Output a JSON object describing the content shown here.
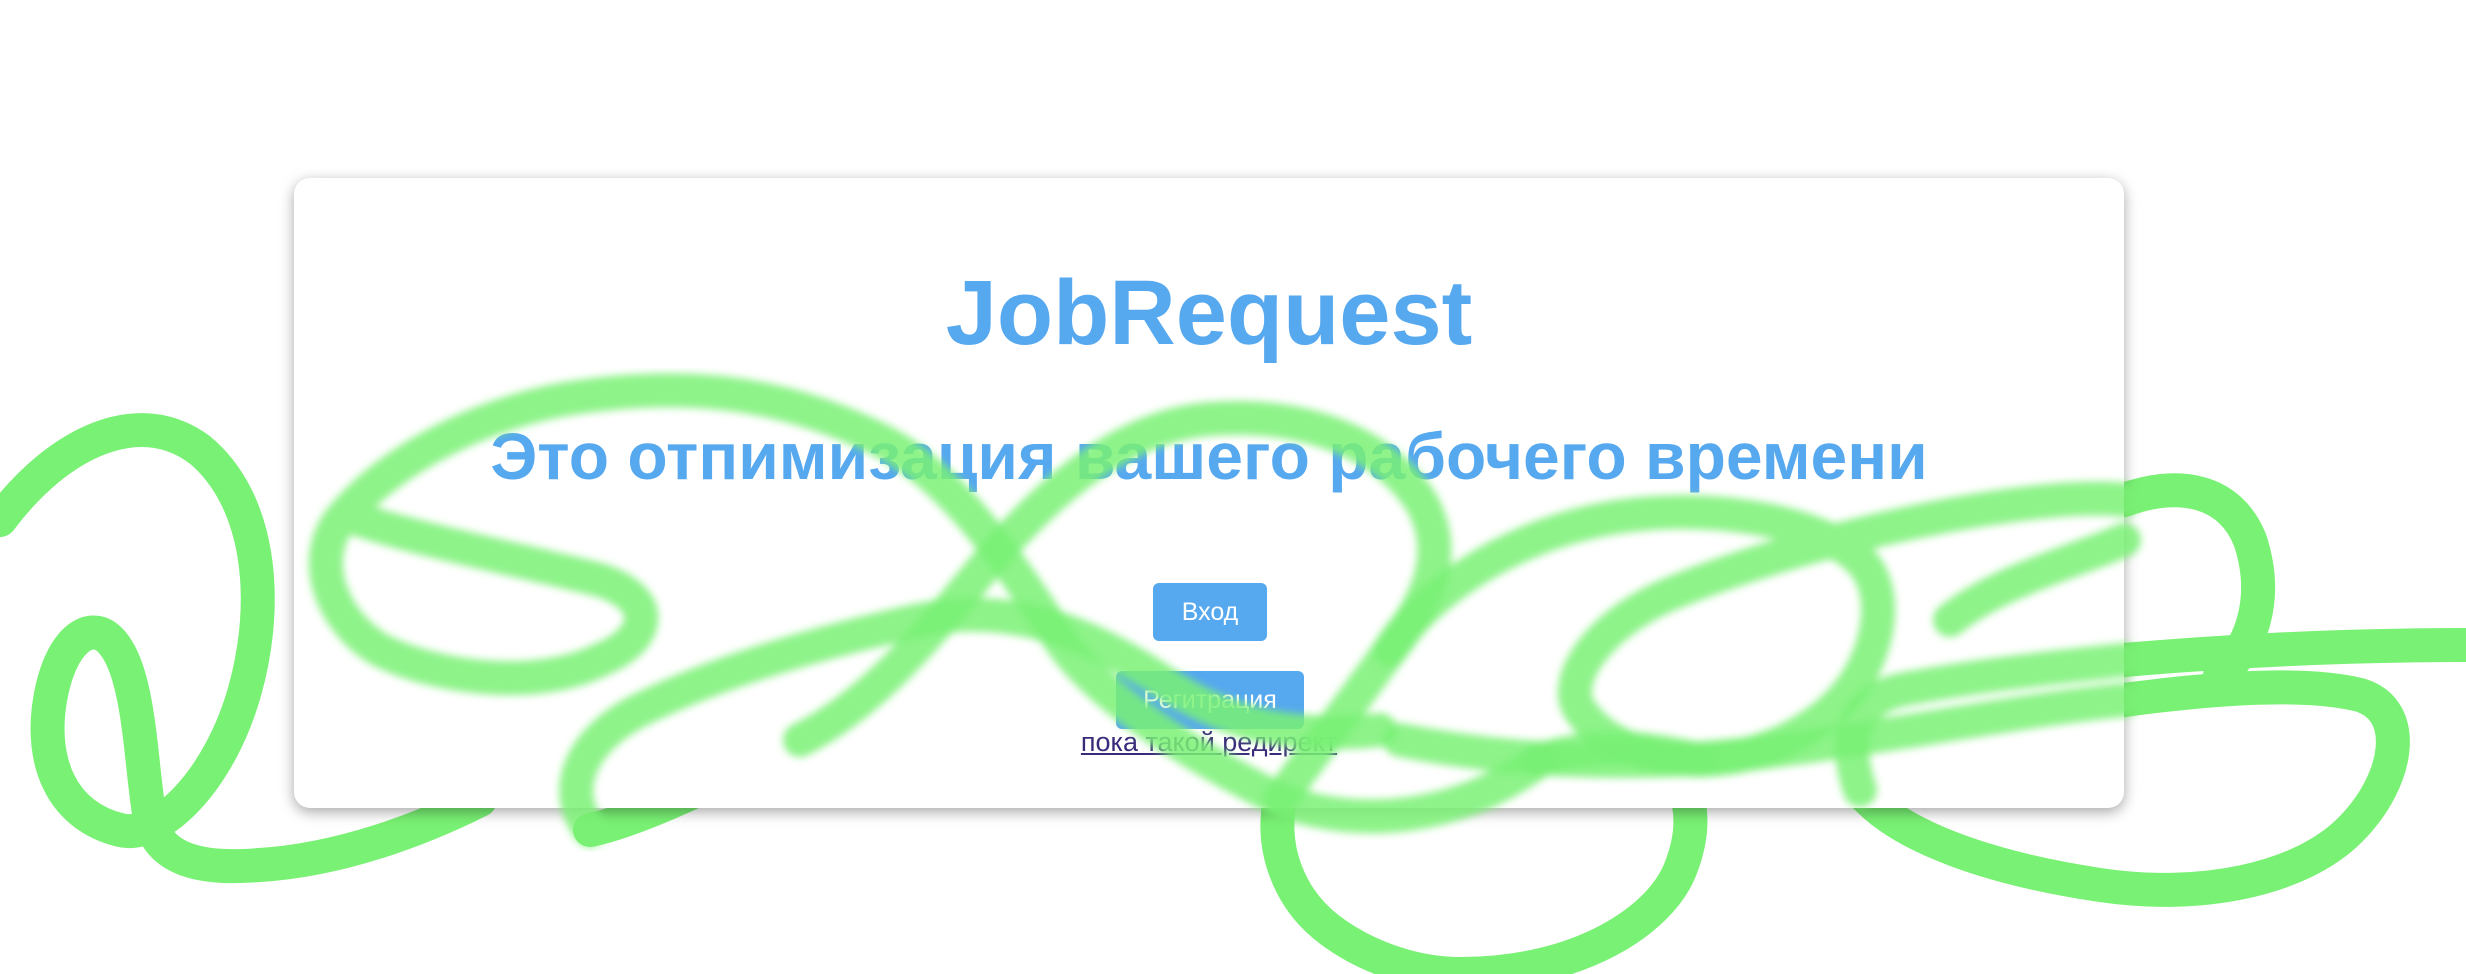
{
  "app": {
    "title": "JobRequest",
    "subtitle": "Это отпимизация вашего рабочего времени"
  },
  "actions": {
    "login_label": "Вход",
    "register_label": "Регитрация",
    "redirect_label": "пока такой редирект"
  },
  "colors": {
    "accent": "#56a8ef",
    "scribble": "#79f174",
    "link": "#3a2b7a",
    "background": "#ffffff"
  }
}
